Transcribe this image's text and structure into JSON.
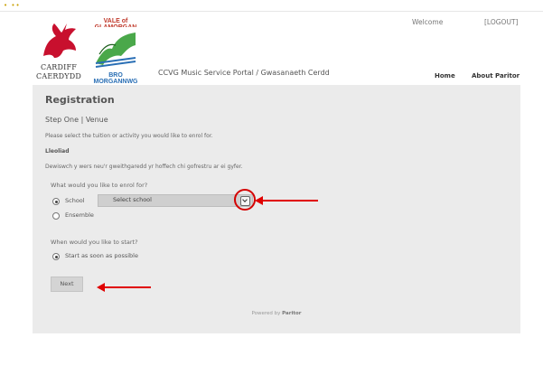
{
  "header": {
    "cardiff_logo_line1": "CARDIFF",
    "cardiff_logo_line2": "CAERDYDD",
    "vale_logo_top": "VALE of GLAMORGAN",
    "vale_logo_bottom": "BRO MORGANNWG",
    "portal_title": "CCVG Music Service Portal / Gwasanaeth Cerdd",
    "welcome": "Welcome",
    "logout": "[LOGOUT]",
    "nav": {
      "home": "Home",
      "about": "About Paritor"
    }
  },
  "main": {
    "title": "Registration",
    "step": "Step One | Venue",
    "instruction_en": "Please select the tuition or activity you would like to enrol for.",
    "lleoliad": "Lleoliad",
    "instruction_cy": "Dewiswch y wers neu'r gweithgaredd yr hoffech chi gofrestru ar ei gyfer.",
    "question_enrol": "What would you like to enrol for?",
    "option_school": "School",
    "select_school": "Select school",
    "option_ensemble": "Ensemble",
    "question_start": "When would you like to start?",
    "option_start": "Start as soon as possible",
    "next": "Next",
    "powered_prefix": "Powered by ",
    "powered_brand": "Paritor"
  },
  "colors": {
    "annotation": "#e00000",
    "panel": "#ebebeb"
  }
}
